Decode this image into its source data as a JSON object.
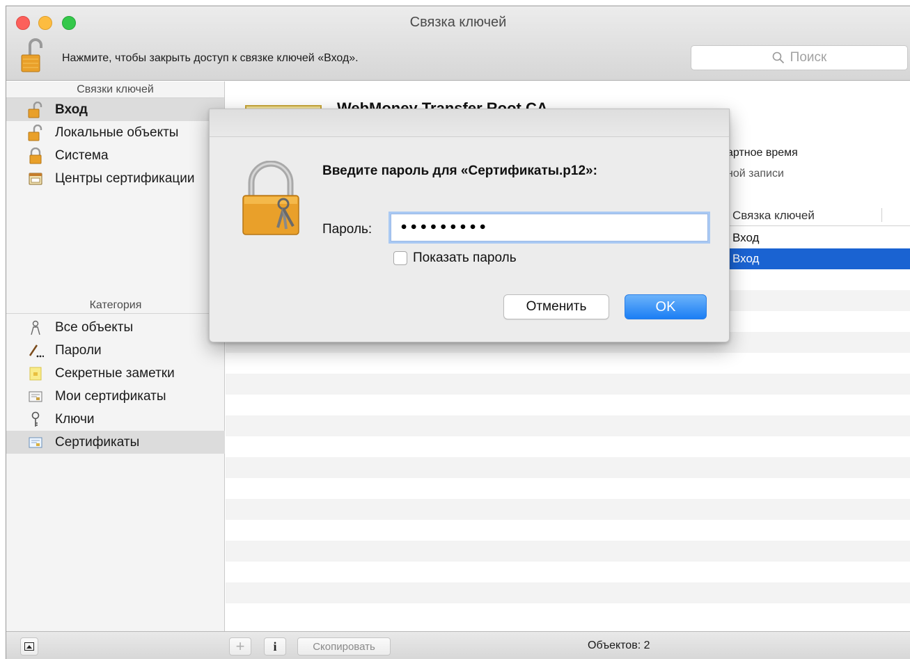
{
  "window": {
    "title": "Связка ключей"
  },
  "toolbar": {
    "lock_hint": "Нажмите, чтобы закрыть доступ к связке ключей «Вход».",
    "search_placeholder": "Поиск"
  },
  "sidebar": {
    "keychains_header": "Связки ключей",
    "keychains": [
      {
        "label": "Вход",
        "icon": "lock-open-icon",
        "selected": true
      },
      {
        "label": "Локальные объекты",
        "icon": "lock-open-icon"
      },
      {
        "label": "Система",
        "icon": "lock-closed-icon"
      },
      {
        "label": "Центры сертификации",
        "icon": "certificate-cabinet-icon"
      }
    ],
    "category_header": "Категория",
    "categories": [
      {
        "label": "Все объекты",
        "icon": "people-icon"
      },
      {
        "label": "Пароли",
        "icon": "pen-icon"
      },
      {
        "label": "Секретные заметки",
        "icon": "note-icon"
      },
      {
        "label": "Мои сертификаты",
        "icon": "my-certificate-icon"
      },
      {
        "label": "Ключи",
        "icon": "key-icon"
      },
      {
        "label": "Сертификаты",
        "icon": "certificate-icon",
        "selected": true
      }
    ]
  },
  "main": {
    "certificate_title": "WebMoney Transfer Root CA",
    "partial_line_1": "артное время",
    "partial_line_2": "ной записи",
    "column_header": "Связка ключей",
    "rows": [
      "Вход",
      "Вход"
    ]
  },
  "dialog": {
    "prompt": "Введите пароль для «Сертификаты.p12»:",
    "password_label": "Пароль:",
    "password_value": "•••••••••",
    "show_password_label": "Показать пароль",
    "show_password_checked": false,
    "cancel_label": "Отменить",
    "ok_label": "OK"
  },
  "bottombar": {
    "add_symbol": "+",
    "info_symbol": "i",
    "copy_label": "Скопировать",
    "count_text": "Объектов: 2"
  },
  "colors": {
    "accent": "#1a63d2",
    "ok_button": "#1b7ef4",
    "lock_gold": "#e9a02a"
  }
}
